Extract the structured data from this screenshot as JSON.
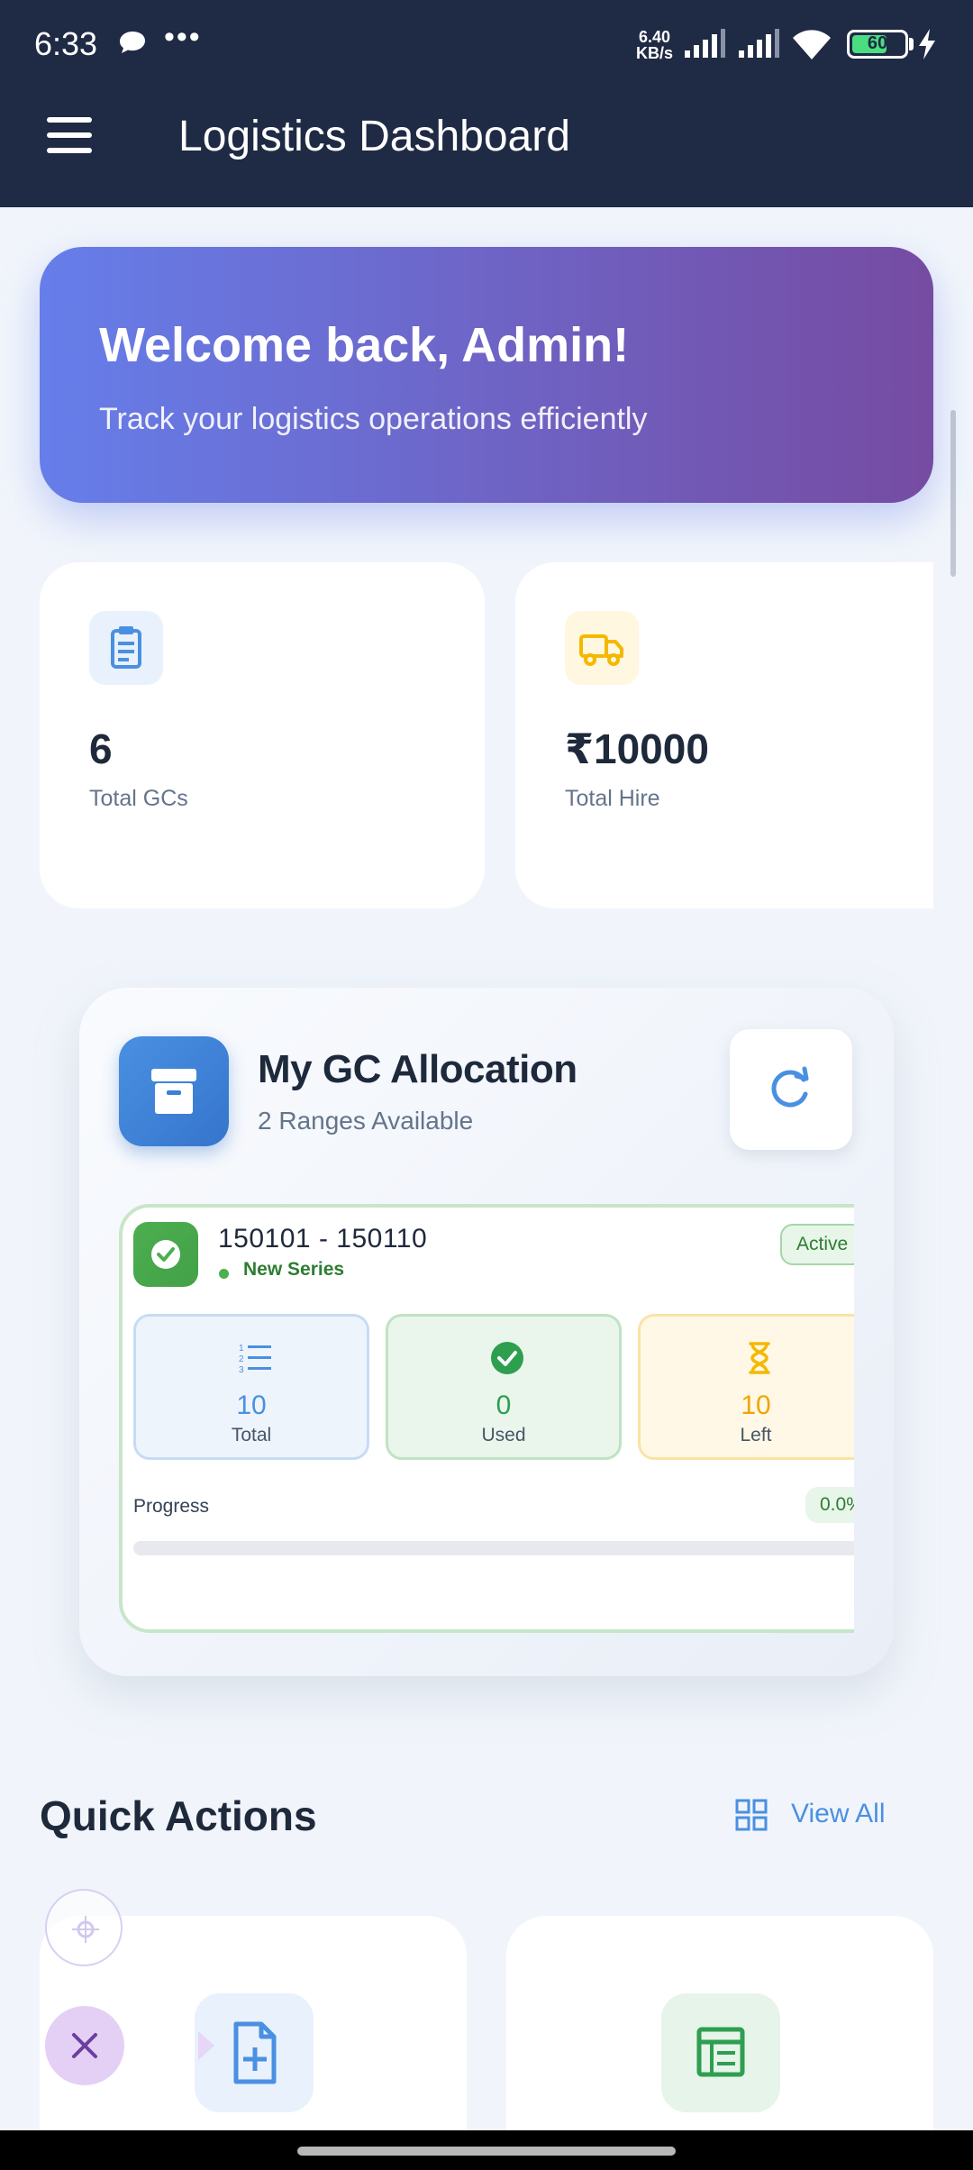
{
  "status_bar": {
    "time": "6:33",
    "speed_value": "6.40",
    "speed_unit": "KB/s",
    "battery": "60"
  },
  "app_bar": {
    "title": "Logistics Dashboard",
    "menu_icon": "menu-icon"
  },
  "welcome": {
    "title": "Welcome back, Admin!",
    "subtitle": "Track your logistics operations efficiently",
    "gradient_start": "#667eea",
    "gradient_end": "#764ba2"
  },
  "stats": [
    {
      "icon": "clipboard-icon",
      "value": "6",
      "label": "Total GCs",
      "color": "#4a90e2",
      "bg": "#e8f1fc"
    },
    {
      "icon": "truck-icon",
      "value": "₹10000",
      "label": "Total Hire",
      "color": "#f5b800",
      "bg": "#fff7e0"
    }
  ],
  "allocation": {
    "title": "My GC Allocation",
    "subtitle": "2 Ranges Available",
    "icon": "archive-box-icon",
    "refresh_icon": "refresh-icon",
    "range": {
      "title": "150101 - 150110",
      "series": "New Series",
      "status": "Active",
      "total_value": "10",
      "total_label": "Total",
      "used_value": "0",
      "used_label": "Used",
      "left_value": "10",
      "left_label": "Left",
      "progress_label": "Progress",
      "progress_text": "0.0%",
      "progress": 0.0
    }
  },
  "quick_actions": {
    "title": "Quick Actions",
    "view_all": "View All",
    "view_all_icon": "grid-icon",
    "items": [
      {
        "icon": "add-document-icon",
        "color": "#4a90e2",
        "bg": "#e8f1fc"
      },
      {
        "icon": "spreadsheet-icon",
        "color": "#2e9e4f",
        "bg": "#e6f4ea"
      }
    ]
  },
  "colors": {
    "app_bar": "#1f2a44",
    "success": "#4caf50",
    "primary": "#4a90e2",
    "warning": "#f5b800"
  }
}
